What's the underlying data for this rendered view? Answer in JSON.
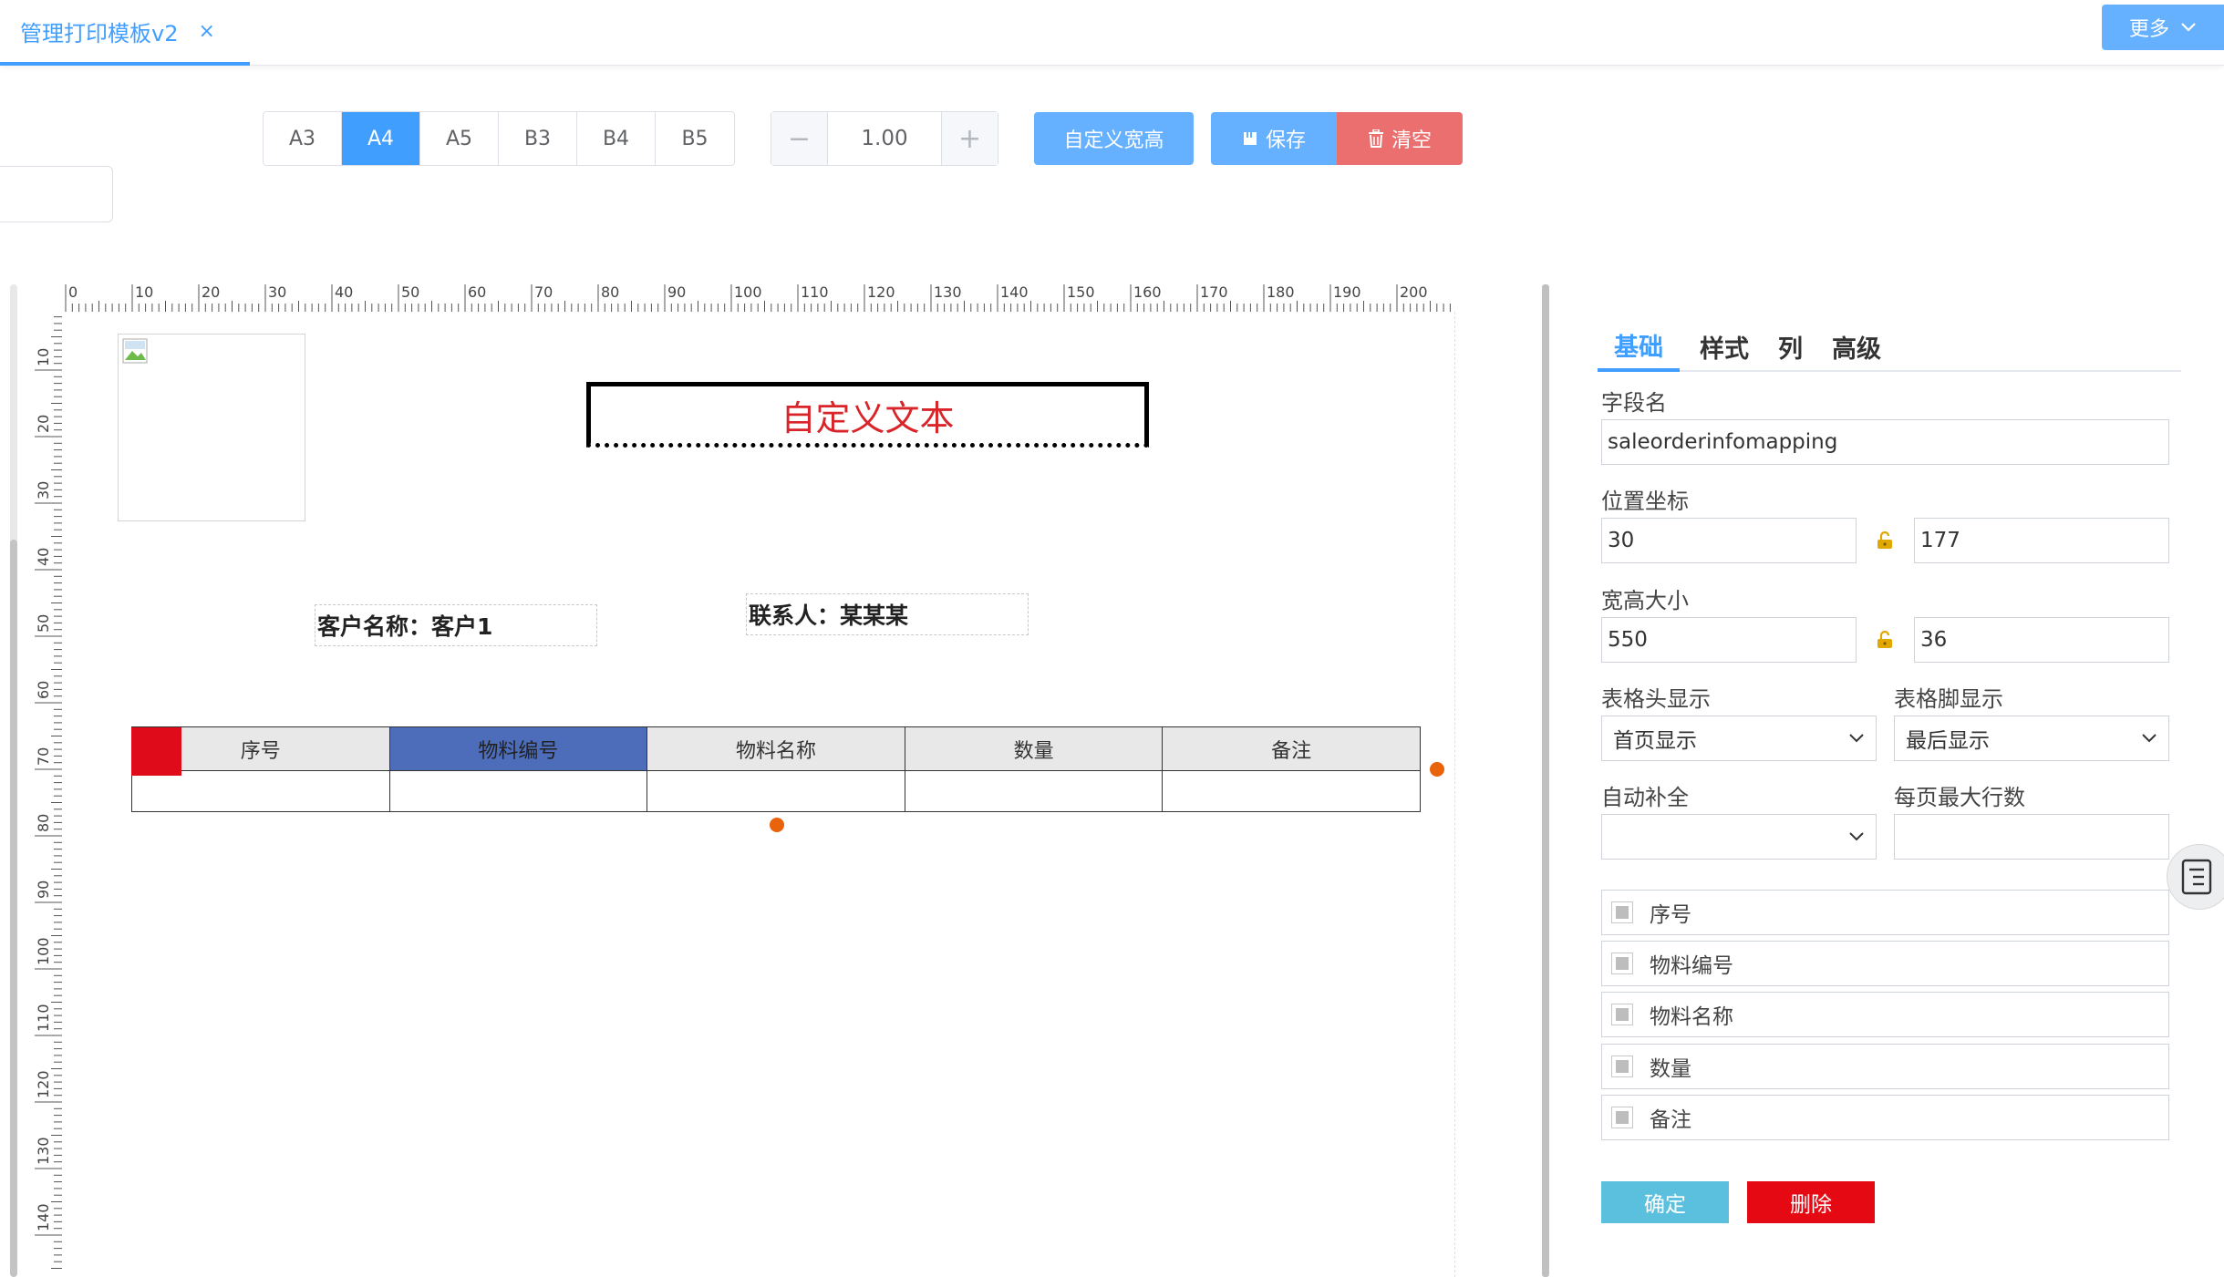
{
  "tab": {
    "title": "管理打印模板v2",
    "close": "×"
  },
  "more_button": {
    "label": "更多"
  },
  "paper_sizes": [
    {
      "label": "A3",
      "active": false
    },
    {
      "label": "A4",
      "active": true
    },
    {
      "label": "A5",
      "active": false
    },
    {
      "label": "B3",
      "active": false
    },
    {
      "label": "B4",
      "active": false
    },
    {
      "label": "B5",
      "active": false
    }
  ],
  "zoom": {
    "minus": "−",
    "value": "1.00",
    "plus": "+"
  },
  "toolbar": {
    "custom_size": "自定义宽高",
    "save": "保存",
    "clear": "清空"
  },
  "rulers": {
    "horizontal": [
      "0",
      "10",
      "20",
      "30",
      "40",
      "50",
      "60",
      "70",
      "80",
      "90",
      "100",
      "110",
      "120",
      "130",
      "140",
      "150",
      "160",
      "170",
      "180",
      "190",
      "200"
    ],
    "vertical": [
      "10",
      "20",
      "30",
      "40",
      "50",
      "60",
      "70",
      "80",
      "90",
      "100",
      "110",
      "120",
      "130",
      "140"
    ]
  },
  "canvas": {
    "custom_text": "自定义文本",
    "customer_field": "客户名称：客户1",
    "contact_field": "联系人：某某某",
    "table": {
      "headers": [
        "序号",
        "物料编号",
        "物料名称",
        "数量",
        "备注"
      ],
      "selected_header": 1
    }
  },
  "panel": {
    "tabs": [
      "基础",
      "样式",
      "列",
      "高级"
    ],
    "active_tab": 0,
    "field_name_label": "字段名",
    "field_name_value": "saleorderinfomapping",
    "position_label": "位置坐标",
    "position_x": "30",
    "position_y": "177",
    "size_label": "宽高大小",
    "width": "550",
    "height": "36",
    "header_display_label": "表格头显示",
    "header_display_value": "首页显示",
    "footer_display_label": "表格脚显示",
    "footer_display_value": "最后显示",
    "autofill_label": "自动补全",
    "autofill_value": "",
    "max_rows_label": "每页最大行数",
    "max_rows_value": "",
    "columns": [
      "序号",
      "物料编号",
      "物料名称",
      "数量",
      "备注"
    ],
    "ok_button": "确定",
    "delete_button": "删除"
  },
  "colors": {
    "primary": "#409eff",
    "button_blue": "#66b1ff",
    "danger": "#eb6f6f",
    "custom_text": "#d9252a",
    "selected_header": "#4d6dbb",
    "handle": "#e8630a",
    "ok": "#5bc0de",
    "delete": "#e50914"
  }
}
